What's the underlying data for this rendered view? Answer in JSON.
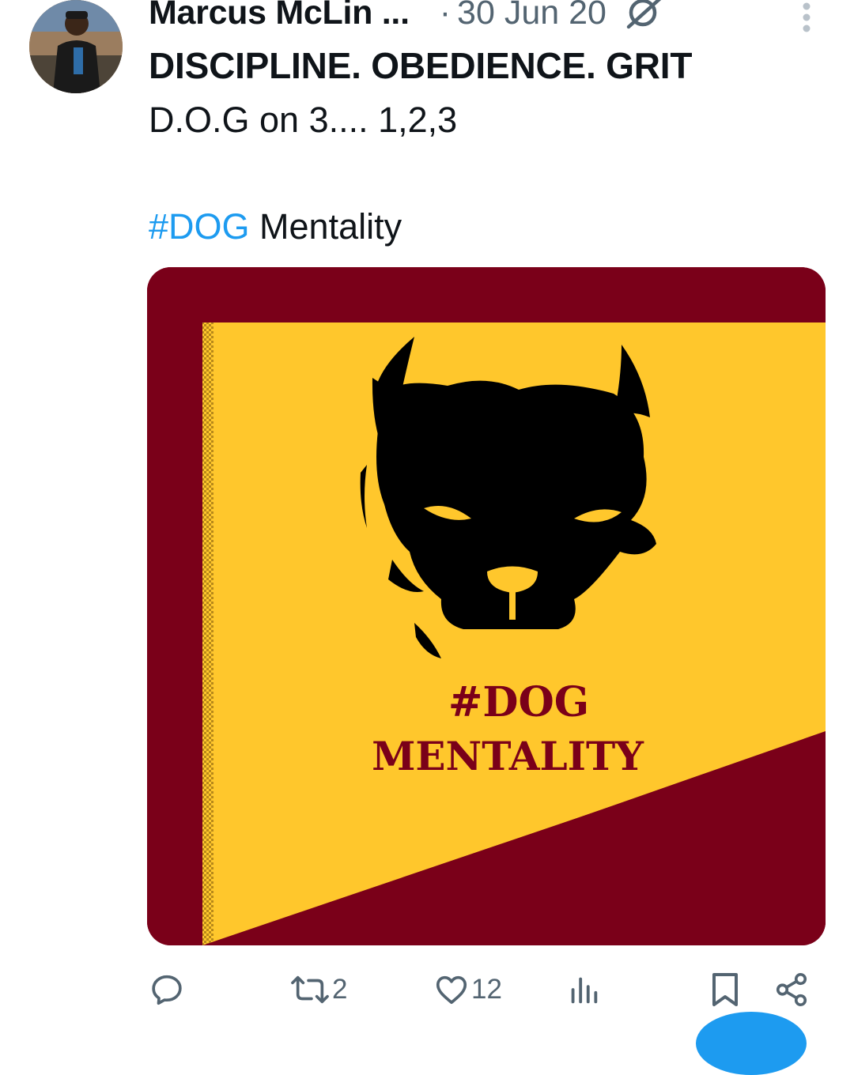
{
  "tweet": {
    "author_name": "Marcus McLin ...",
    "separator": "·",
    "date": "30 Jun 20",
    "headline": "DISCIPLINE. OBEDIENCE. GRIT",
    "body_line": "D.O.G on 3.... 1,2,3",
    "hashtag": "#DOG",
    "hashtag_suffix": "Mentality"
  },
  "media": {
    "graphic_text_line1": "#DOG",
    "graphic_text_line2": "MENTALITY",
    "colors": {
      "maroon": "#7a0019",
      "gold": "#ffc72c",
      "black": "#000000"
    }
  },
  "actions": {
    "reply_count": "",
    "repost_count": "2",
    "like_count": "12",
    "views_count": ""
  },
  "icons": {
    "reply": "reply-icon",
    "repost": "repost-icon",
    "like": "heart-icon",
    "views": "views-icon",
    "bookmark": "bookmark-icon",
    "share": "share-icon",
    "more": "more-icon",
    "edited": "edited-icon"
  },
  "colors": {
    "accent": "#1d9bf0",
    "text_primary": "#0f1419",
    "text_secondary": "#536471"
  }
}
